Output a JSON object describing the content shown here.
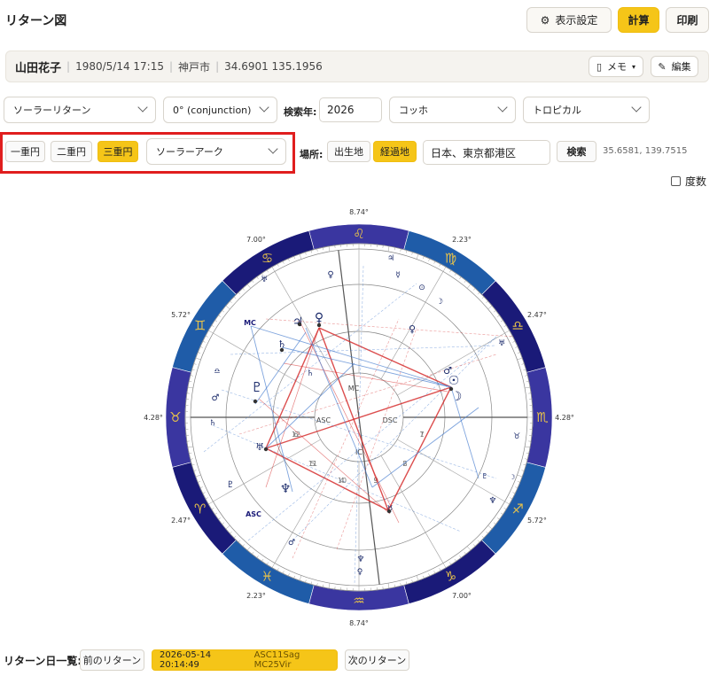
{
  "title": "リターン図",
  "toolbar": {
    "display_settings": "表示設定",
    "calculate": "計算",
    "print": "印刷"
  },
  "profile": {
    "name": "山田花子",
    "datetime": "1980/5/14 17:15",
    "place": "神戸市",
    "coords": "34.6901 135.1956",
    "memo": "メモ",
    "edit": "編集"
  },
  "options": {
    "return_type": "ソーラーリターン",
    "aspect": "0° (conjunction)",
    "year_label": "検索年:",
    "year": "2026",
    "house_system": "コッホ",
    "zodiac": "トロピカル"
  },
  "circles": {
    "single": "一重円",
    "double": "二重円",
    "triple": "三重円",
    "progression": "ソーラーアーク"
  },
  "location": {
    "label": "場所:",
    "birth": "出生地",
    "current": "経過地",
    "place": "日本、東京都港区",
    "search": "検索",
    "coords": "35.6581, 139.7515"
  },
  "degrees_label": "度数",
  "chart": {
    "axis_labels": {
      "mc": "MC",
      "ic": "IC",
      "asc": "ASC",
      "dsc": "DSC"
    },
    "outer_labels": {
      "asc": "ASC",
      "mc": "MC"
    },
    "house_numbers": [
      "1",
      "2",
      "3",
      "4",
      "5",
      "6",
      "7",
      "8",
      "9",
      "10",
      "11",
      "12"
    ],
    "cusp_degrees": [
      "8.74°",
      "2.23°",
      "2.47°",
      "4.28°",
      "5.72°",
      "7.00°",
      "8.74°",
      "2.23°",
      "2.47°",
      "4.28°",
      "5.72°",
      "7.00°"
    ],
    "sign_glyphs": [
      "♌",
      "♋",
      "♊",
      "♉",
      "♈",
      "♓",
      "♒",
      "♑",
      "♐",
      "♏",
      "♎",
      "♍"
    ],
    "colors": {
      "ring_dark": "#1a1a78",
      "ring_mid": "#3a36a0",
      "ring_blue": "#1f5ca8",
      "aspect_red": "#d63030",
      "aspect_blue": "#4a7fd0"
    }
  },
  "returns": {
    "label": "リターン日一覧:",
    "prev": "前のリターン",
    "current_date": "2026-05-14 20:14:49",
    "current_extra": "ASC11Sag MC25Vir",
    "next": "次のリターン"
  }
}
